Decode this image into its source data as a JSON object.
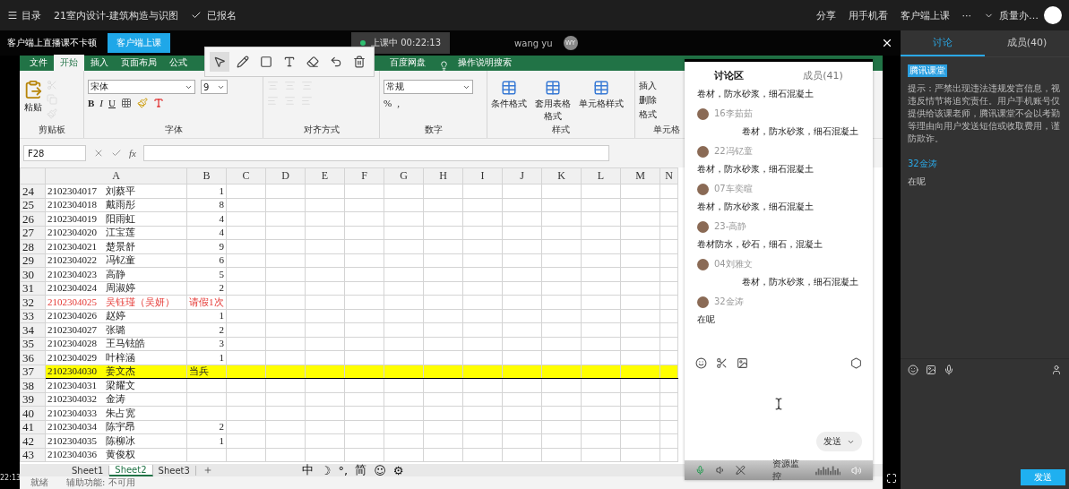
{
  "topbar": {
    "menu": "目录",
    "course": "21室内设计-建筑构造与识图",
    "enrolled": "已报名",
    "actions": [
      "分享",
      "用手机看",
      "客户端上课",
      "···"
    ],
    "user": "质量办…"
  },
  "video": {
    "promo": "客户端上直播课不卡顿",
    "promo_button": "客户端上课",
    "status": "上课中 00:22:13",
    "teacher": "wang yu",
    "teacher_initials": "WY",
    "time": "22:13"
  },
  "annotation_tools": [
    {
      "kind": "select",
      "selected": true
    },
    {
      "kind": "pen",
      "selected": false
    },
    {
      "kind": "rect",
      "selected": false
    },
    {
      "kind": "text",
      "selected": false
    },
    {
      "kind": "eraser",
      "selected": false
    },
    {
      "kind": "undo",
      "selected": false
    },
    {
      "kind": "delete",
      "selected": false
    }
  ],
  "excel": {
    "tabs_left": [
      {
        "label": "文件",
        "selected": false
      },
      {
        "label": "开始",
        "selected": true
      },
      {
        "label": "插入",
        "selected": false
      },
      {
        "label": "页面布局",
        "selected": false
      },
      {
        "label": "公式",
        "selected": false
      }
    ],
    "tabs_right": [
      {
        "label": "百度网盘",
        "selected": false
      }
    ],
    "search": "操作说明搜索",
    "ribbon": {
      "paste": "粘贴",
      "clipboard_group": "剪贴板",
      "font_name": "宋体",
      "font_size": "9",
      "font_styles": [
        "B",
        "I",
        "U"
      ],
      "font_group": "字体",
      "align_group": "对齐方式",
      "number_format": "常规",
      "number_symbols": [
        "%",
        ","
      ],
      "number_group": "数字",
      "style_buttons": [
        "条件格式",
        "套用表格格式",
        "单元格样式"
      ],
      "style_group": "样式",
      "cell_buttons": [
        "插入",
        "删除",
        "格式"
      ],
      "cell_group": "单元格"
    },
    "formula_bar": {
      "cell": "F28",
      "fx": "fx"
    },
    "columns": [
      "A",
      "B",
      "C",
      "D",
      "E",
      "F",
      "G",
      "H",
      "I",
      "J",
      "K",
      "L",
      "M",
      "N"
    ],
    "rows": [
      {
        "num": "24",
        "id": "2102304017",
        "name": "刘蔡平",
        "b": "1",
        "flagged": false,
        "highlighted": false
      },
      {
        "num": "25",
        "id": "2102304018",
        "name": "戴雨彤",
        "b": "8",
        "flagged": false,
        "highlighted": false
      },
      {
        "num": "26",
        "id": "2102304019",
        "name": "阳雨虹",
        "b": "4",
        "flagged": false,
        "highlighted": false
      },
      {
        "num": "27",
        "id": "2102304020",
        "name": "江宝莲",
        "b": "4",
        "flagged": false,
        "highlighted": false
      },
      {
        "num": "28",
        "id": "2102304021",
        "name": "楚景舒",
        "b": "9",
        "flagged": false,
        "highlighted": false
      },
      {
        "num": "29",
        "id": "2102304022",
        "name": "冯钇童",
        "b": "6",
        "flagged": false,
        "highlighted": false
      },
      {
        "num": "30",
        "id": "2102304023",
        "name": "高静",
        "b": "5",
        "flagged": false,
        "highlighted": false
      },
      {
        "num": "31",
        "id": "2102304024",
        "name": "周淑婷",
        "b": "2",
        "flagged": false,
        "highlighted": false
      },
      {
        "num": "32",
        "id": "2102304025",
        "name": "吴钰瑾（吴妍）",
        "b": "请假1次",
        "flagged": true,
        "highlighted": false
      },
      {
        "num": "33",
        "id": "2102304026",
        "name": "赵婷",
        "b": "1",
        "flagged": false,
        "highlighted": false
      },
      {
        "num": "34",
        "id": "2102304027",
        "name": "张璐",
        "b": "2",
        "flagged": false,
        "highlighted": false
      },
      {
        "num": "35",
        "id": "2102304028",
        "name": "王马铉皓",
        "b": "3",
        "flagged": false,
        "highlighted": false
      },
      {
        "num": "36",
        "id": "2102304029",
        "name": "叶梓涵",
        "b": "1",
        "flagged": false,
        "highlighted": false
      },
      {
        "num": "37",
        "id": "2102304030",
        "name": "姜文杰",
        "b": "当兵",
        "flagged": false,
        "highlighted": true
      },
      {
        "num": "38",
        "id": "2102304031",
        "name": "梁耀文",
        "flagged": false,
        "highlighted": false
      },
      {
        "num": "39",
        "id": "2102304032",
        "name": "金涛",
        "flagged": false,
        "highlighted": false
      },
      {
        "num": "40",
        "id": "2102304033",
        "name": "朱占宽",
        "flagged": false,
        "highlighted": false
      },
      {
        "num": "41",
        "id": "2102304034",
        "name": "陈宇昂",
        "b": "2",
        "flagged": false,
        "highlighted": false
      },
      {
        "num": "42",
        "id": "2102304035",
        "name": "陈柳冰",
        "b": "1",
        "flagged": false,
        "highlighted": false
      },
      {
        "num": "43",
        "id": "2102304036",
        "name": "黄俊权",
        "flagged": false,
        "highlighted": false
      }
    ],
    "sheets": [
      {
        "label": "Sheet1",
        "selected": false
      },
      {
        "label": "Sheet2",
        "selected": true
      },
      {
        "label": "Sheet3",
        "selected": false
      }
    ],
    "ime": [
      "中",
      "☽",
      "°,",
      "简",
      "☺",
      "⚙"
    ],
    "status": [
      "就绪",
      "辅助功能: 不可用"
    ]
  },
  "chat": {
    "tabs": [
      {
        "label": "讨论区",
        "selected": true
      },
      {
        "label": "成员(41)",
        "selected": false
      }
    ],
    "messages": [
      {
        "text": "卷材，防水砂浆，细石混凝土",
        "offset": false
      },
      {
        "name": "16李茹茹",
        "text": "卷材，防水砂浆，细石混凝土",
        "offset": true
      },
      {
        "name": "22冯钇童",
        "text": "卷材，防水砂浆，细石混凝土",
        "offset": false
      },
      {
        "name": "07车奕暄",
        "text": "卷材，防水砂浆，细石混凝土",
        "offset": false
      },
      {
        "name": "23-高静",
        "text": "卷材防水，砂石，细石，混凝土",
        "offset": false
      },
      {
        "name": "04刘雅文",
        "text": "卷材，防水砂浆，细石混凝土",
        "offset": true
      },
      {
        "name": "32金涛",
        "text": "在呢",
        "offset": false
      }
    ],
    "send": "发送",
    "monitor": "资源监控"
  },
  "sidebar": {
    "tabs": [
      {
        "label": "讨论",
        "selected": true
      },
      {
        "label": "成员(40)",
        "selected": false
      }
    ],
    "badge": "腾讯课堂",
    "notice": "提示：严禁出现违法违规发言信息，视违反情节将追究责任。用户手机账号仅提供给该课老师，腾讯课堂不会以考勤等理由向用户发送短信或收取费用，谨防欺诈。",
    "messages": [
      {
        "name": "32金涛",
        "text": "在呢"
      }
    ],
    "send": "发送"
  }
}
